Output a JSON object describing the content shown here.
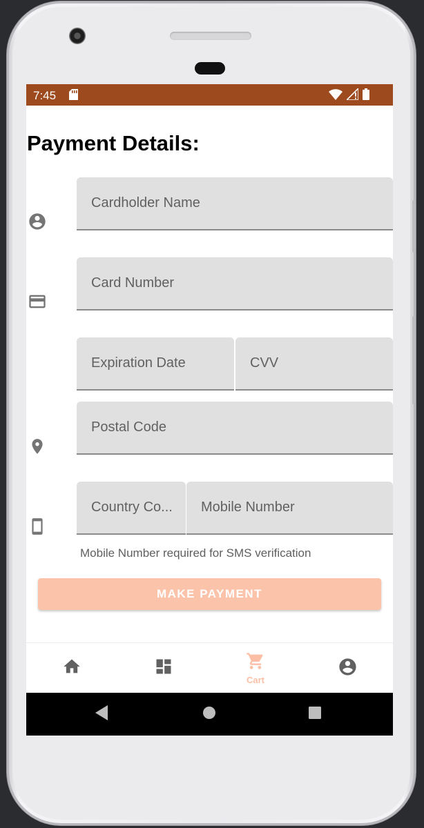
{
  "status_bar": {
    "time": "7:45"
  },
  "page": {
    "title": "Payment Details:"
  },
  "form": {
    "cardholder_name": {
      "placeholder": "Cardholder Name",
      "value": ""
    },
    "card_number": {
      "placeholder": "Card Number",
      "value": ""
    },
    "expiration_date": {
      "placeholder": "Expiration Date",
      "value": ""
    },
    "cvv": {
      "placeholder": "CVV",
      "value": ""
    },
    "postal_code": {
      "placeholder": "Postal Code",
      "value": ""
    },
    "country_code": {
      "placeholder": "Country Co...",
      "value": ""
    },
    "mobile_number": {
      "placeholder": "Mobile Number",
      "value": ""
    },
    "mobile_helper": "Mobile Number required for SMS verification"
  },
  "actions": {
    "make_payment_label": "MAKE PAYMENT"
  },
  "bottom_nav": {
    "items": [
      {
        "id": "home",
        "icon": "home-icon",
        "label": ""
      },
      {
        "id": "dashboard",
        "icon": "dashboard-icon",
        "label": ""
      },
      {
        "id": "cart",
        "icon": "cart-icon",
        "label": "Cart",
        "active": true
      },
      {
        "id": "account",
        "icon": "account-icon",
        "label": ""
      }
    ]
  },
  "colors": {
    "status_bar": "#9c4a1e",
    "accent_disabled": "#fcc3ab",
    "field_bg": "#e0e0e0",
    "nav_active": "#fcbfa6"
  }
}
